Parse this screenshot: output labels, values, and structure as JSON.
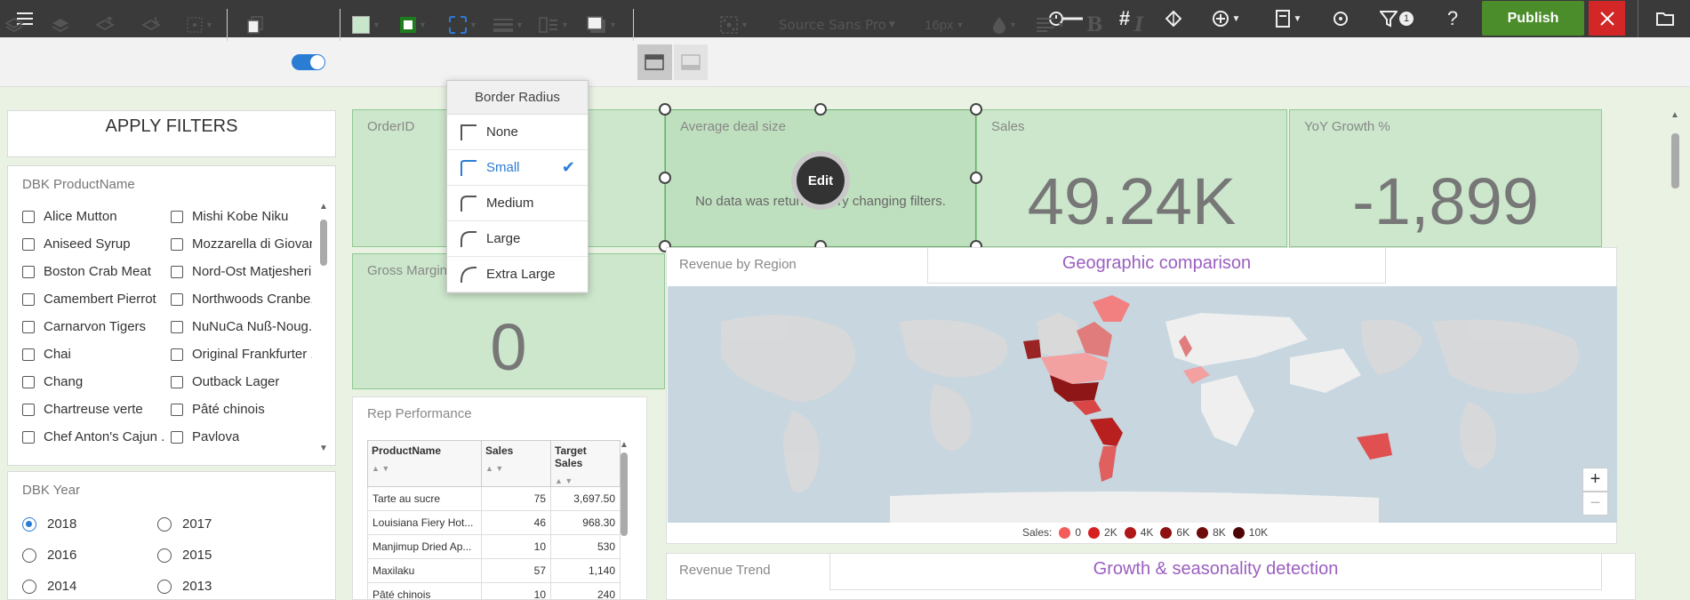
{
  "topbar": {
    "publish_label": "Publish",
    "filter_badge": "1",
    "help_glyph": "?"
  },
  "toolbar": {
    "font_family": "Source Sans Pro",
    "font_size": "16px",
    "bold_glyph": "B",
    "italic_glyph": "I",
    "fill_color": "#c8e6c9",
    "border_color": "#1e7b1e"
  },
  "border_radius_menu": {
    "title": "Border Radius",
    "options": [
      "None",
      "Small",
      "Medium",
      "Large",
      "Extra Large"
    ],
    "selected": "Small"
  },
  "filters": {
    "apply_label": "APPLY FILTERS",
    "product_title": "DBK ProductName",
    "products_col1": [
      "Alice Mutton",
      "Aniseed Syrup",
      "Boston Crab Meat",
      "Camembert Pierrot",
      "Carnarvon Tigers",
      "Chai",
      "Chang",
      "Chartreuse verte",
      "Chef Anton's Cajun ..."
    ],
    "products_col2": [
      "Mishi Kobe Niku",
      "Mozzarella di Giovan",
      "Nord-Ost Matjesheri..",
      "Northwoods Cranbe..",
      "NuNuCa Nuß-Noug...",
      "Original Frankfurter ...",
      "Outback Lager",
      "Pâté chinois",
      "Pavlova"
    ],
    "year_title": "DBK Year",
    "years_col1": [
      "2018",
      "2016",
      "2014"
    ],
    "years_col2": [
      "2017",
      "2015",
      "2013"
    ],
    "selected_year": "2018"
  },
  "kpis": {
    "orderid": {
      "title": "OrderID"
    },
    "avg_deal": {
      "title": "Average deal size",
      "message": "No data was returned. Try changing filters.",
      "edit_label": "Edit"
    },
    "sales": {
      "title": "Sales",
      "value": "49.24K"
    },
    "yoy": {
      "title": "YoY Growth %",
      "value": "-1,899"
    },
    "gross_margin": {
      "title": "Gross Margin",
      "value": "0"
    }
  },
  "map": {
    "title": "Revenue by Region",
    "tagline": "Geographic comparison",
    "zoom_in": "+",
    "zoom_out": "−",
    "legend_label": "Sales:",
    "legend": [
      {
        "label": "0",
        "color": "#f45b5b"
      },
      {
        "label": "2K",
        "color": "#d72020"
      },
      {
        "label": "4K",
        "color": "#b01818"
      },
      {
        "label": "6K",
        "color": "#8e1010"
      },
      {
        "label": "8K",
        "color": "#6e0a0a"
      },
      {
        "label": "10K",
        "color": "#4e0505"
      }
    ]
  },
  "rep": {
    "title": "Rep Performance",
    "columns": [
      "ProductName",
      "Sales",
      "Target Sales"
    ],
    "rows": [
      [
        "Tarte au sucre",
        "75",
        "3,697.50"
      ],
      [
        "Louisiana Fiery Hot...",
        "46",
        "968.30"
      ],
      [
        "Manjimup Dried Ap...",
        "10",
        "530"
      ],
      [
        "Maxilaku",
        "57",
        "1,140"
      ],
      [
        "Pâté chinois",
        "10",
        "240"
      ]
    ]
  },
  "trend": {
    "title": "Revenue Trend",
    "tagline": "Growth & seasonality detection"
  }
}
